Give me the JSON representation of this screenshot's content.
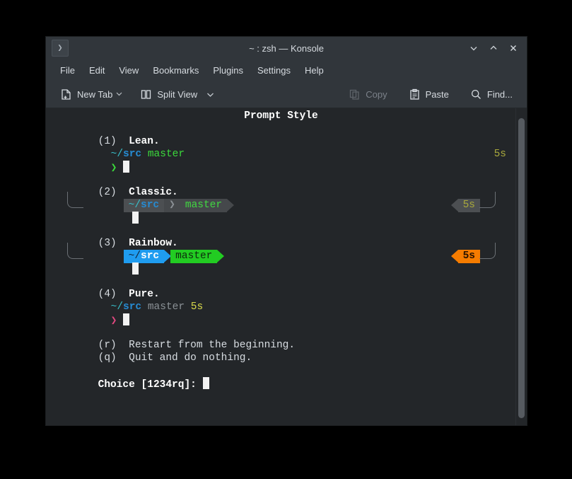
{
  "window": {
    "title": "~ : zsh — Konsole",
    "app_icon": "terminal-prompt-icon",
    "controls": {
      "minimize": "minimize-icon",
      "maximize": "maximize-icon",
      "close": "close-icon"
    }
  },
  "menubar": {
    "items": [
      {
        "label": "File"
      },
      {
        "label": "Edit"
      },
      {
        "label": "View"
      },
      {
        "label": "Bookmarks"
      },
      {
        "label": "Plugins"
      },
      {
        "label": "Settings"
      },
      {
        "label": "Help"
      }
    ]
  },
  "toolbar": {
    "new_tab": "New Tab",
    "split_view": "Split View",
    "copy": "Copy",
    "paste": "Paste",
    "find": "Find..."
  },
  "terminal": {
    "heading": "Prompt Style",
    "options": [
      {
        "key": "(1)",
        "name": "Lean.",
        "style": "lean",
        "path_home": "~/",
        "path_dir": "src",
        "branch": "master",
        "prompt_char": "❯",
        "duration": "5s"
      },
      {
        "key": "(2)",
        "name": "Classic.",
        "style": "classic",
        "path_home": "~/",
        "path_dir": "src",
        "separator": "❯",
        "branch": "master",
        "duration": "5s"
      },
      {
        "key": "(3)",
        "name": "Rainbow.",
        "style": "rainbow",
        "path_home": "~/",
        "path_dir": "src",
        "branch": "master",
        "duration": "5s"
      },
      {
        "key": "(4)",
        "name": "Pure.",
        "style": "pure",
        "path_home": "~/",
        "path_dir": "src",
        "branch": "master",
        "duration": "5s",
        "prompt_char": "❯"
      }
    ],
    "actions": [
      {
        "key": "(r)",
        "label": "Restart from the beginning."
      },
      {
        "key": "(q)",
        "label": "Quit and do nothing."
      }
    ],
    "choice_prompt": "Choice [1234rq]:"
  },
  "colors": {
    "terminal_bg": "#232629",
    "chrome_bg": "#31363b",
    "rainbow_blue": "#1f9cf0",
    "rainbow_green": "#22cc22",
    "rainbow_orange": "#f57c00",
    "classic_segment": "#4c4f52",
    "green": "#3bd93b",
    "blue": "#268bd2",
    "cyan": "#2aa198",
    "pink": "#e0487f",
    "olive": "#a8a83c"
  }
}
